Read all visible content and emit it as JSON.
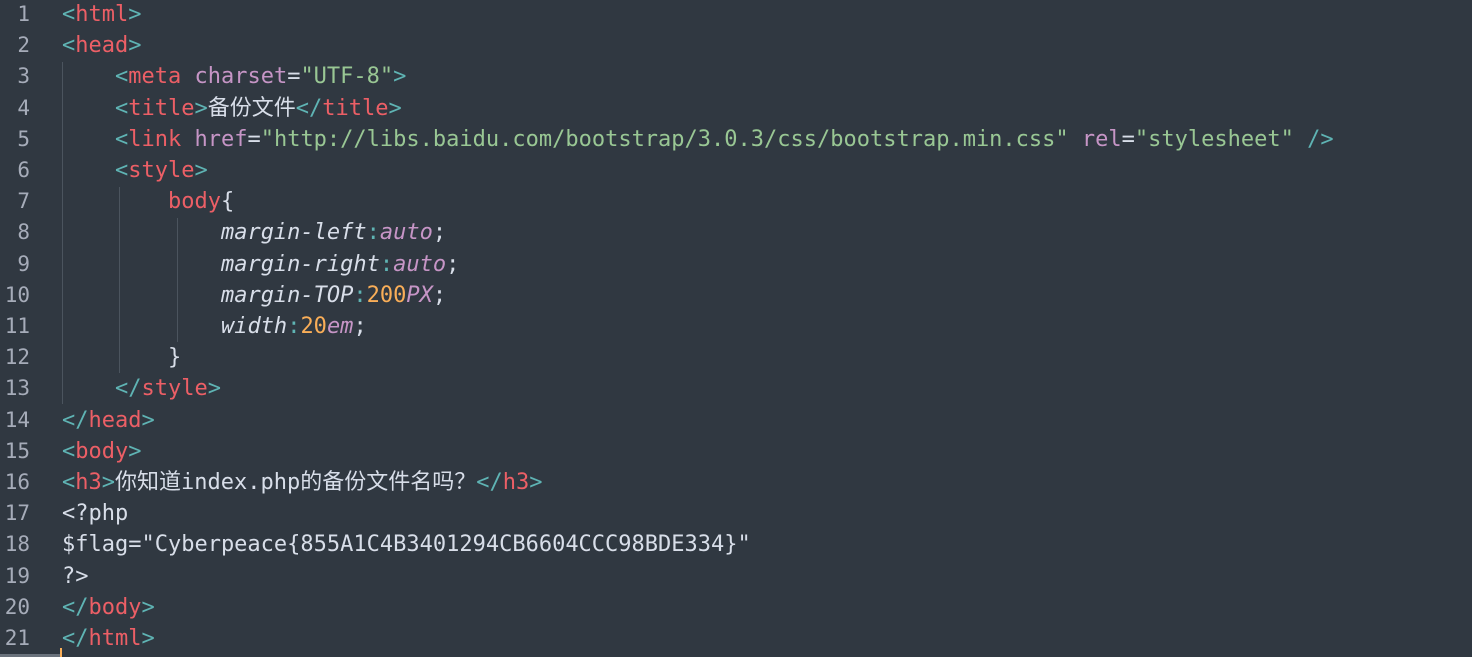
{
  "editor": {
    "lines": [
      {
        "n": "1",
        "tokens": [
          {
            "t": "<",
            "c": "t-punct"
          },
          {
            "t": "html",
            "c": "t-tag"
          },
          {
            "t": ">",
            "c": "t-punct"
          }
        ]
      },
      {
        "n": "2",
        "tokens": [
          {
            "t": "<",
            "c": "t-punct"
          },
          {
            "t": "head",
            "c": "t-tag"
          },
          {
            "t": ">",
            "c": "t-punct"
          }
        ]
      },
      {
        "n": "3",
        "tokens": [
          {
            "t": "    ",
            "c": "t-text"
          },
          {
            "t": "<",
            "c": "t-punct"
          },
          {
            "t": "meta",
            "c": "t-tag"
          },
          {
            "t": " ",
            "c": "t-text"
          },
          {
            "t": "charset",
            "c": "t-attr"
          },
          {
            "t": "=",
            "c": "t-eq"
          },
          {
            "t": "\"UTF-8\"",
            "c": "t-str"
          },
          {
            "t": ">",
            "c": "t-punct"
          }
        ]
      },
      {
        "n": "4",
        "tokens": [
          {
            "t": "    ",
            "c": "t-text"
          },
          {
            "t": "<",
            "c": "t-punct"
          },
          {
            "t": "title",
            "c": "t-tag"
          },
          {
            "t": ">",
            "c": "t-punct"
          },
          {
            "t": "备份文件",
            "c": "t-text"
          },
          {
            "t": "</",
            "c": "t-punct"
          },
          {
            "t": "title",
            "c": "t-tag"
          },
          {
            "t": ">",
            "c": "t-punct"
          }
        ]
      },
      {
        "n": "5",
        "tokens": [
          {
            "t": "    ",
            "c": "t-text"
          },
          {
            "t": "<",
            "c": "t-punct"
          },
          {
            "t": "link",
            "c": "t-tag"
          },
          {
            "t": " ",
            "c": "t-text"
          },
          {
            "t": "href",
            "c": "t-attr"
          },
          {
            "t": "=",
            "c": "t-eq"
          },
          {
            "t": "\"http://libs.baidu.com/bootstrap/3.0.3/css/bootstrap.min.css\"",
            "c": "t-str"
          },
          {
            "t": " ",
            "c": "t-text"
          },
          {
            "t": "rel",
            "c": "t-attr"
          },
          {
            "t": "=",
            "c": "t-eq"
          },
          {
            "t": "\"stylesheet\"",
            "c": "t-str"
          },
          {
            "t": " ",
            "c": "t-text"
          },
          {
            "t": "/>",
            "c": "t-punct"
          }
        ]
      },
      {
        "n": "6",
        "tokens": [
          {
            "t": "    ",
            "c": "t-text"
          },
          {
            "t": "<",
            "c": "t-punct"
          },
          {
            "t": "style",
            "c": "t-tag"
          },
          {
            "t": ">",
            "c": "t-punct"
          }
        ]
      },
      {
        "n": "7",
        "tokens": [
          {
            "t": "        ",
            "c": "t-text"
          },
          {
            "t": "body",
            "c": "t-sel"
          },
          {
            "t": "{",
            "c": "t-brace"
          }
        ]
      },
      {
        "n": "8",
        "tokens": [
          {
            "t": "            ",
            "c": "t-text"
          },
          {
            "t": "margin-left",
            "c": "t-prop"
          },
          {
            "t": ":",
            "c": "t-colon"
          },
          {
            "t": "auto",
            "c": "t-const"
          },
          {
            "t": ";",
            "c": "t-semi"
          }
        ]
      },
      {
        "n": "9",
        "tokens": [
          {
            "t": "            ",
            "c": "t-text"
          },
          {
            "t": "margin-right",
            "c": "t-prop"
          },
          {
            "t": ":",
            "c": "t-colon"
          },
          {
            "t": "auto",
            "c": "t-const"
          },
          {
            "t": ";",
            "c": "t-semi"
          }
        ]
      },
      {
        "n": "10",
        "tokens": [
          {
            "t": "            ",
            "c": "t-text"
          },
          {
            "t": "margin-TOP",
            "c": "t-prop"
          },
          {
            "t": ":",
            "c": "t-colon"
          },
          {
            "t": "200",
            "c": "t-num"
          },
          {
            "t": "PX",
            "c": "t-const"
          },
          {
            "t": ";",
            "c": "t-semi"
          }
        ]
      },
      {
        "n": "11",
        "tokens": [
          {
            "t": "            ",
            "c": "t-text"
          },
          {
            "t": "width",
            "c": "t-prop"
          },
          {
            "t": ":",
            "c": "t-colon"
          },
          {
            "t": "20",
            "c": "t-num"
          },
          {
            "t": "em",
            "c": "t-const"
          },
          {
            "t": ";",
            "c": "t-semi"
          }
        ]
      },
      {
        "n": "12",
        "tokens": [
          {
            "t": "        ",
            "c": "t-text"
          },
          {
            "t": "}",
            "c": "t-brace"
          }
        ]
      },
      {
        "n": "13",
        "tokens": [
          {
            "t": "    ",
            "c": "t-text"
          },
          {
            "t": "</",
            "c": "t-punct"
          },
          {
            "t": "style",
            "c": "t-tag"
          },
          {
            "t": ">",
            "c": "t-punct"
          }
        ]
      },
      {
        "n": "14",
        "tokens": [
          {
            "t": "</",
            "c": "t-punct"
          },
          {
            "t": "head",
            "c": "t-tag"
          },
          {
            "t": ">",
            "c": "t-punct"
          }
        ]
      },
      {
        "n": "15",
        "tokens": [
          {
            "t": "<",
            "c": "t-punct"
          },
          {
            "t": "body",
            "c": "t-tag"
          },
          {
            "t": ">",
            "c": "t-punct"
          }
        ]
      },
      {
        "n": "16",
        "tokens": [
          {
            "t": "<",
            "c": "t-punct"
          },
          {
            "t": "h3",
            "c": "t-tag"
          },
          {
            "t": ">",
            "c": "t-punct"
          },
          {
            "t": "你知道index.php的备份文件名吗？",
            "c": "t-text"
          },
          {
            "t": "</",
            "c": "t-punct"
          },
          {
            "t": "h3",
            "c": "t-tag"
          },
          {
            "t": ">",
            "c": "t-punct"
          }
        ]
      },
      {
        "n": "17",
        "tokens": [
          {
            "t": "<?php",
            "c": "t-text"
          }
        ]
      },
      {
        "n": "18",
        "tokens": [
          {
            "t": "$flag=\"Cyberpeace{855A1C4B3401294CB6604CCC98BDE334}\"",
            "c": "t-text"
          }
        ]
      },
      {
        "n": "19",
        "tokens": [
          {
            "t": "?>",
            "c": "t-text"
          }
        ]
      },
      {
        "n": "20",
        "tokens": [
          {
            "t": "</",
            "c": "t-punct"
          },
          {
            "t": "body",
            "c": "t-tag"
          },
          {
            "t": ">",
            "c": "t-punct"
          }
        ]
      },
      {
        "n": "21",
        "tokens": [
          {
            "t": "</",
            "c": "t-punct"
          },
          {
            "t": "html",
            "c": "t-tag"
          },
          {
            "t": ">",
            "c": "t-punct"
          }
        ]
      }
    ]
  }
}
